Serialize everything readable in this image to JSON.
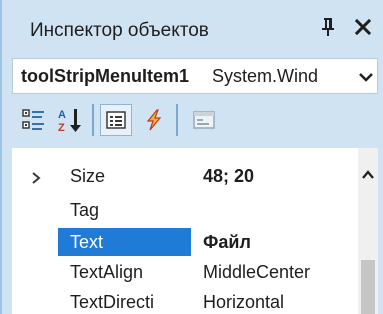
{
  "window": {
    "title": "Инспектор объектов",
    "pin_icon": "pin-icon",
    "close_icon": "close-icon"
  },
  "selector": {
    "object_name": "toolStripMenuItem1",
    "object_type": "System.Wind",
    "dropdown_icon": "chevron-down-icon"
  },
  "toolbar": {
    "buttons": [
      {
        "name": "categorized-view-button",
        "icon": "categorized-icon",
        "checked": false
      },
      {
        "name": "alphabetical-view-button",
        "icon": "sort-az-icon",
        "checked": false
      },
      {
        "name": "properties-button",
        "icon": "properties-icon",
        "checked": true
      },
      {
        "name": "events-button",
        "icon": "lightning-icon",
        "checked": false
      },
      {
        "name": "property-pages-button",
        "icon": "property-pages-icon",
        "checked": false
      }
    ]
  },
  "grid": {
    "rows": [
      {
        "name": "Size",
        "value": "48; 20",
        "value_bold": true,
        "selected": false,
        "expandable": true
      },
      {
        "name": "Tag",
        "value": "",
        "value_bold": false,
        "selected": false,
        "expandable": false
      },
      {
        "name": "Text",
        "value": "Файл",
        "value_bold": true,
        "selected": true,
        "expandable": false
      },
      {
        "name": "TextAlign",
        "value": "MiddleCenter",
        "value_bold": false,
        "selected": false,
        "expandable": false
      },
      {
        "name": "TextDirecti",
        "value": "Horizontal",
        "value_bold": false,
        "selected": false,
        "expandable": false
      }
    ]
  },
  "colors": {
    "panel_background": "#cfe3f3",
    "selection": "#1f7bd6",
    "text": "#1e1e1e"
  }
}
